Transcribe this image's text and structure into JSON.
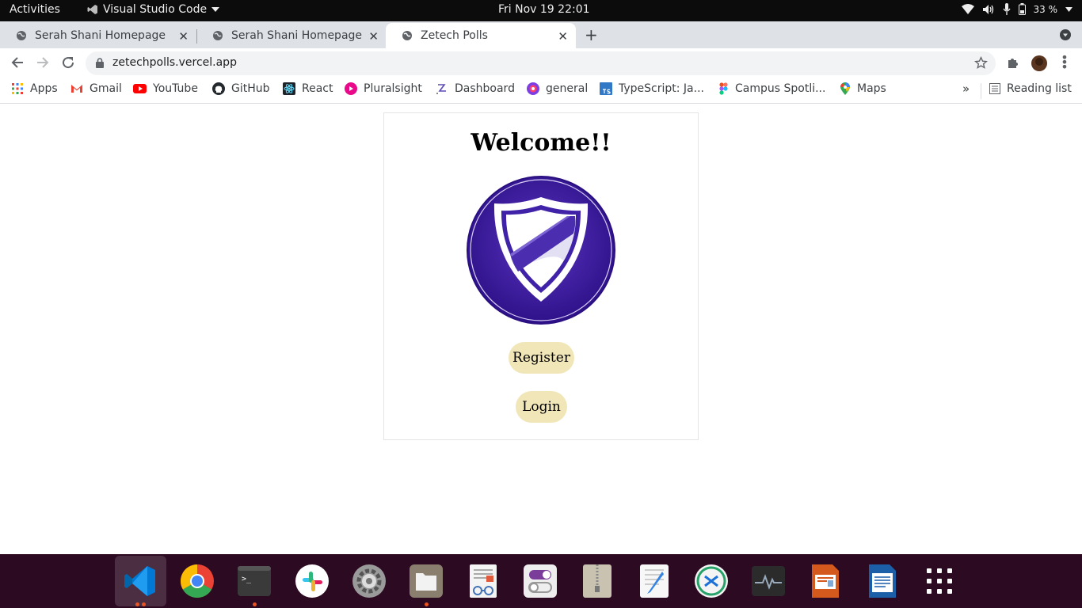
{
  "topbar": {
    "activities": "Activities",
    "app_name": "Visual Studio Code",
    "clock": "Fri Nov 19  22:01",
    "battery": "33 %"
  },
  "tabs": [
    {
      "title": "Serah Shani Homepage",
      "active": false
    },
    {
      "title": "Serah Shani Homepage",
      "active": false
    },
    {
      "title": "Zetech Polls",
      "active": true
    }
  ],
  "toolbar": {
    "url": "zetechpolls.vercel.app"
  },
  "bookmarks": [
    {
      "label": "Apps",
      "icon": "apps-grid-icon",
      "color": "#4285f4"
    },
    {
      "label": "Gmail",
      "icon": "gmail-icon",
      "color": "#ea4335"
    },
    {
      "label": "YouTube",
      "icon": "youtube-icon",
      "color": "#ff0000"
    },
    {
      "label": "GitHub",
      "icon": "github-icon",
      "color": "#24292e"
    },
    {
      "label": "React",
      "icon": "react-icon",
      "color": "#20232a"
    },
    {
      "label": "Pluralsight",
      "icon": "pluralsight-icon",
      "color": "#e80a89"
    },
    {
      "label": "Dashboard",
      "icon": "dashboard-icon",
      "color": "#5f6368"
    },
    {
      "label": "general",
      "icon": "slack-general-icon",
      "color": "#d6249f"
    },
    {
      "label": "TypeScript: Ja...",
      "icon": "typescript-icon",
      "color": "#3178c6"
    },
    {
      "label": "Campus Spotli...",
      "icon": "figma-icon",
      "color": "#a259ff"
    },
    {
      "label": "Maps",
      "icon": "maps-pin-icon",
      "color": "#34a853"
    }
  ],
  "bookmarks_more": "»",
  "reading_list": "Reading list",
  "main": {
    "heading": "Welcome!!",
    "register_label": "Register",
    "login_label": "Login"
  },
  "colors": {
    "button_bg": "#f0e6b8",
    "logo_purple": "#3b1a9c",
    "dock_bg": "#2c0a22",
    "accent_dot": "#e95420"
  },
  "dock": [
    "vscode-icon",
    "chrome-icon",
    "terminal-icon",
    "slack-icon",
    "settings-icon",
    "files-icon",
    "document-viewer-icon",
    "tweaks-icon",
    "archive-icon",
    "text-editor-icon",
    "remote-desktop-icon",
    "system-monitor-icon",
    "impress-icon",
    "writer-icon",
    "app-grid-icon"
  ]
}
